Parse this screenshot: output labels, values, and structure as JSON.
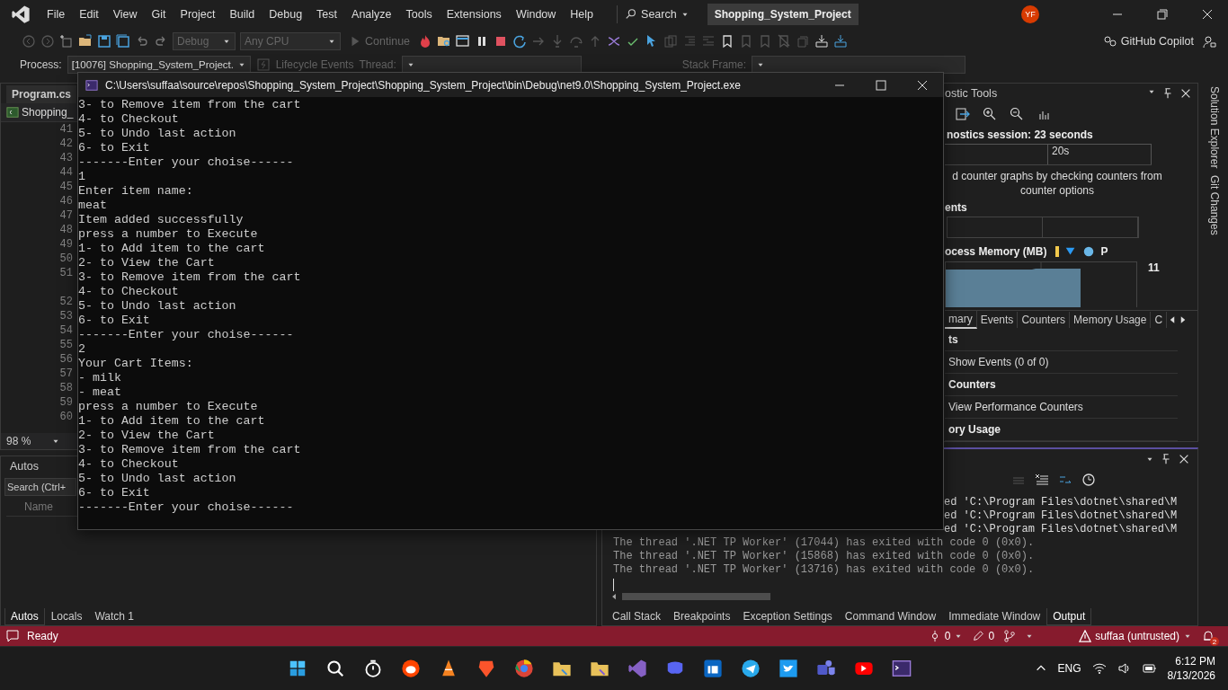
{
  "title_bar": {
    "menus": [
      "File",
      "Edit",
      "View",
      "Git",
      "Project",
      "Build",
      "Debug",
      "Test",
      "Analyze",
      "Tools",
      "Extensions",
      "Window",
      "Help"
    ],
    "search": "Search",
    "solution": "Shopping_System_Project",
    "avatar": "YF"
  },
  "toolbar": {
    "configuration": "Debug",
    "platform": "Any CPU",
    "continue": "Continue",
    "copilot": "GitHub Copilot"
  },
  "debug_location": {
    "process_label": "Process:",
    "process": "[10076] Shopping_System_Project.",
    "lifecycle": "Lifecycle Events",
    "thread_label": "Thread:",
    "stack_frame_label": "Stack Frame:"
  },
  "editor": {
    "tab": "Program.cs",
    "nav": "Shopping_",
    "zoom": "98 %",
    "lines": [
      {
        "number": "41",
        "wrapped": false
      },
      {
        "number": "42",
        "wrapped": false
      },
      {
        "number": "43",
        "wrapped": false
      },
      {
        "number": "44",
        "wrapped": false
      },
      {
        "number": "45",
        "wrapped": false
      },
      {
        "number": "46",
        "wrapped": false
      },
      {
        "number": "47",
        "wrapped": false
      },
      {
        "number": "48",
        "wrapped": false
      },
      {
        "number": "49",
        "wrapped": false
      },
      {
        "number": "50",
        "wrapped": false
      },
      {
        "number": "51",
        "wrapped": true
      },
      {
        "number": "52",
        "wrapped": false
      },
      {
        "number": "53",
        "wrapped": false
      },
      {
        "number": "54",
        "wrapped": false
      },
      {
        "number": "55",
        "wrapped": false
      },
      {
        "number": "56",
        "wrapped": false
      },
      {
        "number": "57",
        "wrapped": false
      },
      {
        "number": "58",
        "wrapped": false
      },
      {
        "number": "59",
        "wrapped": false
      },
      {
        "number": "60",
        "wrapped": false
      }
    ]
  },
  "autos": {
    "title": "Autos",
    "search": "Search (Ctrl+",
    "column": "Name"
  },
  "left_tabs": [
    {
      "label": "Autos",
      "selected": true
    },
    {
      "label": "Locals",
      "selected": false
    },
    {
      "label": "Watch 1",
      "selected": false
    }
  ],
  "diagnostics": {
    "title": "ostic Tools",
    "session": "nostics session: 23 seconds",
    "timeline_label": "20s",
    "hint_lines": [
      "d counter graphs by checking counters from",
      "counter options"
    ],
    "events_label": "ents",
    "memory_label": "ocess Memory (MB)",
    "legend": "P",
    "memory_max": "11",
    "tabs": [
      {
        "label": "mary",
        "selected": true
      },
      {
        "label": "Events",
        "selected": false
      },
      {
        "label": "Counters",
        "selected": false
      },
      {
        "label": "Memory Usage",
        "selected": false
      },
      {
        "label": "C",
        "selected": false
      }
    ],
    "rows": [
      {
        "kind": "header",
        "label": "ts"
      },
      {
        "kind": "link",
        "label": "Show Events (0 of 0)"
      },
      {
        "kind": "header",
        "label": "Counters"
      },
      {
        "kind": "link",
        "label": "View Performance Counters"
      },
      {
        "kind": "header",
        "label": "ory Usage"
      }
    ]
  },
  "output": {
    "lines": [
      {
        "kind": "covered",
        "text": "ed 'C:\\Program Files\\dotnet\\shared\\M"
      },
      {
        "kind": "covered",
        "text": "ed 'C:\\Program Files\\dotnet\\shared\\M"
      },
      {
        "kind": "covered",
        "text": "ed 'C:\\Program Files\\dotnet\\shared\\M"
      },
      {
        "kind": "full",
        "text": "The thread '.NET TP Worker' (17044) has exited with code 0 (0x0)."
      },
      {
        "kind": "full",
        "text": "The thread '.NET TP Worker' (15868) has exited with code 0 (0x0)."
      },
      {
        "kind": "full",
        "text": "The thread '.NET TP Worker' (13716) has exited with code 0 (0x0)."
      }
    ]
  },
  "bottom_tabs": [
    {
      "label": "Call Stack",
      "selected": false
    },
    {
      "label": "Breakpoints",
      "selected": false
    },
    {
      "label": "Exception Settings",
      "selected": false
    },
    {
      "label": "Command Window",
      "selected": false
    },
    {
      "label": "Immediate Window",
      "selected": false
    },
    {
      "label": "Output",
      "selected": true
    }
  ],
  "side_tabs": [
    "Solution Explorer",
    "Git Changes"
  ],
  "console": {
    "title": "C:\\Users\\suffaa\\source\\repos\\Shopping_System_Project\\Shopping_System_Project\\bin\\Debug\\net9.0\\Shopping_System_Project.exe",
    "lines": [
      "3- to Remove item from the cart",
      "4- to Checkout",
      "5- to Undo last action",
      "6- to Exit",
      "-------Enter your choise------",
      "1",
      "Enter item name:",
      "meat",
      "Item added successfully",
      "press a number to Execute",
      "1- to Add item to the cart",
      "2- to View the Cart",
      "3- to Remove item from the cart",
      "4- to Checkout",
      "5- to Undo last action",
      "6- to Exit",
      "-------Enter your choise------",
      "2",
      "Your Cart Items:",
      "- milk",
      "- meat",
      "press a number to Execute",
      "1- to Add item to the cart",
      "2- to View the Cart",
      "3- to Remove item from the cart",
      "4- to Checkout",
      "5- to Undo last action",
      "6- to Exit",
      "-------Enter your choise------"
    ]
  },
  "status_bar": {
    "text": "Ready",
    "line_changes": "0",
    "edits": "0",
    "account": "suffaa (untrusted)",
    "notifications": "2"
  },
  "taskbar": {
    "language": "ENG",
    "time": "6:12 PM",
    "date": "8/13/2026"
  }
}
